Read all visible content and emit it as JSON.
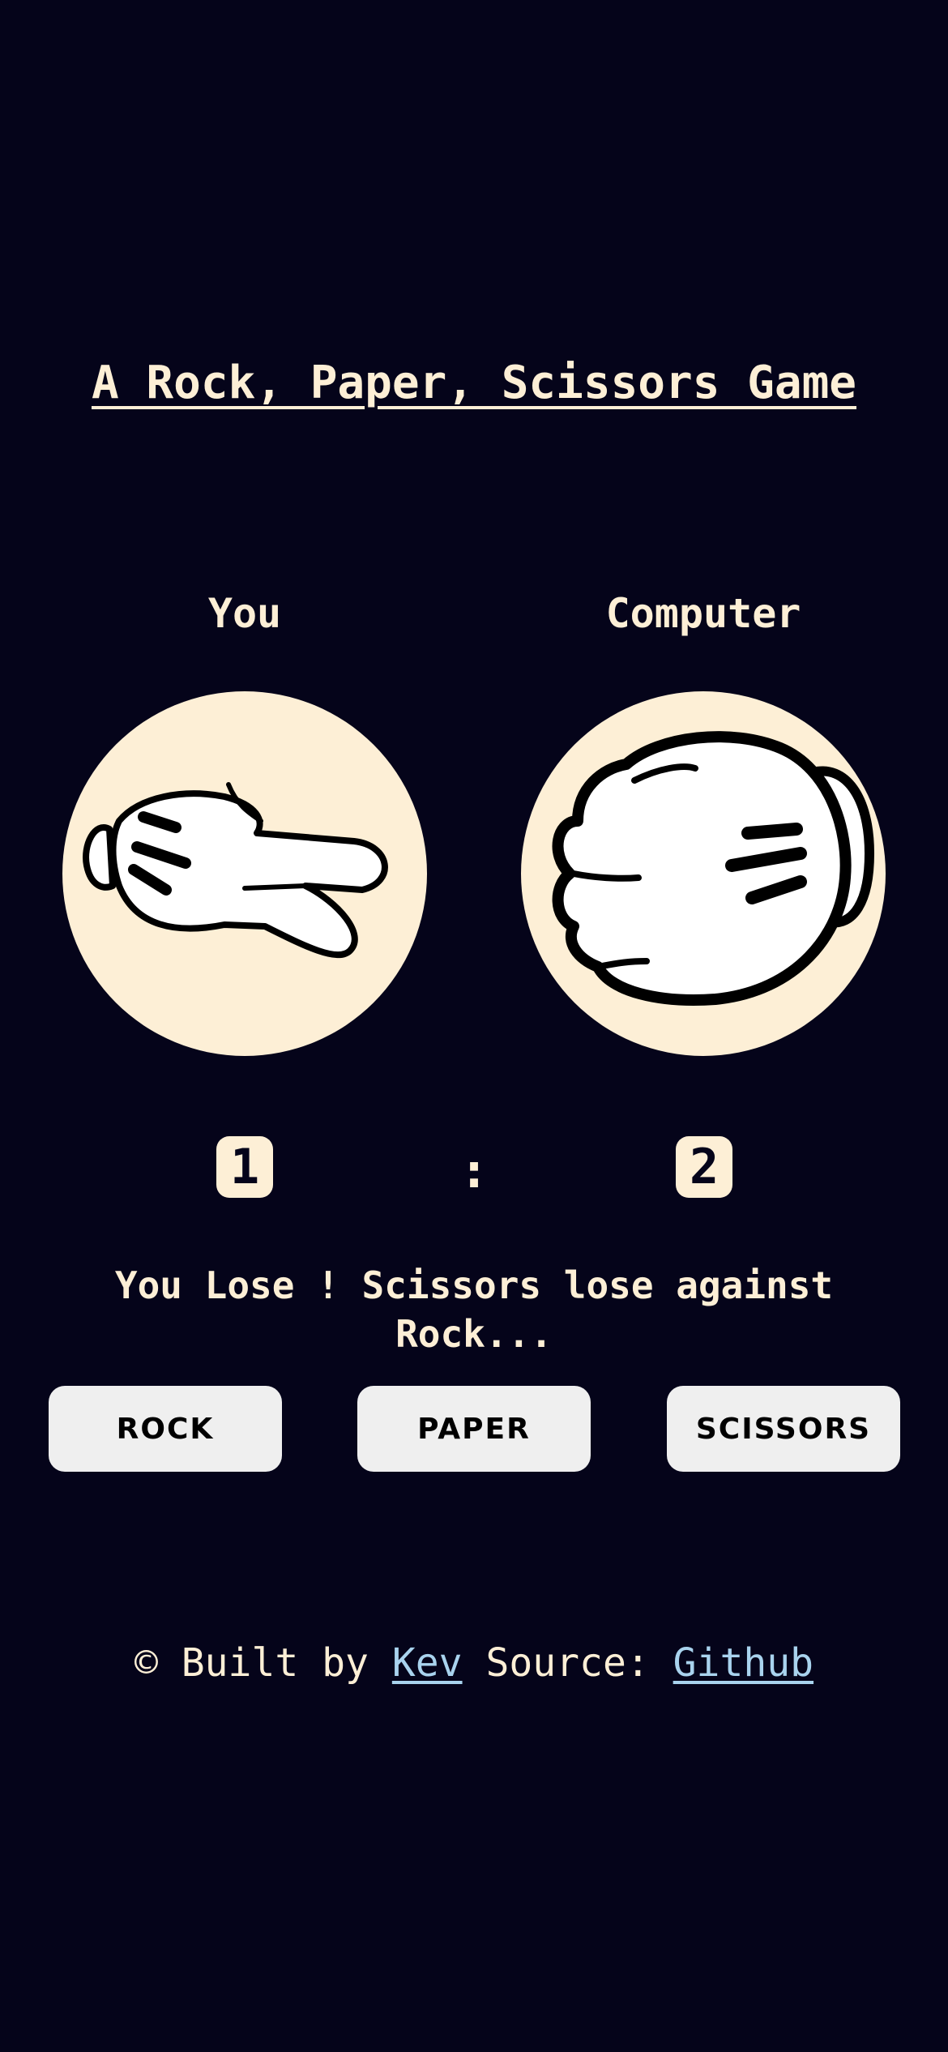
{
  "title": "A Rock, Paper, Scissors Game",
  "players": {
    "you": {
      "label": "You",
      "hand": "scissors-hand-icon",
      "score": "1"
    },
    "computer": {
      "label": "Computer",
      "hand": "rock-fist-icon",
      "score": "2"
    }
  },
  "score_separator": ":",
  "result_text": "You Lose ! Scissors lose against Rock...",
  "buttons": {
    "rock": "ROCK",
    "paper": "PAPER",
    "scissors": "SCISSORS"
  },
  "footer": {
    "prefix": "© Built by",
    "author_link": "Kev",
    "source_label": "Source:",
    "source_link": "Github"
  },
  "colors": {
    "background": "#05041a",
    "cream": "#fdefd6",
    "link": "#a9d3ee",
    "button": "#efefef"
  }
}
